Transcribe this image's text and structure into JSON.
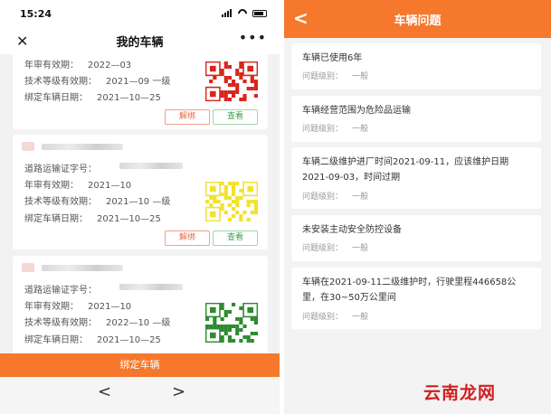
{
  "status": {
    "time": "15:24"
  },
  "left": {
    "title": "我的车辆",
    "close_icon": "close-icon",
    "more_icon": "more-icon",
    "cards": [
      {
        "rows": [
          {
            "label": "年审有效期：",
            "value": "2022—03"
          },
          {
            "label": "技术等级有效期：",
            "value": "2021—09 一级"
          },
          {
            "label": "绑定车辆日期：",
            "value": "2021—10—25"
          }
        ],
        "qr_color": "#d9261c",
        "buttons": {
          "unbind": "解绑",
          "view": "查看"
        }
      },
      {
        "rows": [
          {
            "label": "道路运输证字号：",
            "value": ""
          },
          {
            "label": "年审有效期：",
            "value": "2021—10"
          },
          {
            "label": "技术等级有效期：",
            "value": "2021—10 —级"
          },
          {
            "label": "绑定车辆日期：",
            "value": "2021—10—25"
          }
        ],
        "qr_color": "#f2e22a",
        "buttons": {
          "unbind": "解绑",
          "view": "查看"
        }
      },
      {
        "rows": [
          {
            "label": "道路运输证字号：",
            "value": ""
          },
          {
            "label": "年审有效期：",
            "value": "2021—10"
          },
          {
            "label": "技术等级有效期：",
            "value": "2022—10 —级"
          },
          {
            "label": "绑定车辆日期：",
            "value": "2021—10—25"
          }
        ],
        "qr_color": "#2e8b2e"
      }
    ],
    "bind_button": "绑定车辆",
    "nav": {
      "prev": "<",
      "next": ">"
    }
  },
  "right": {
    "title": "车辆问题",
    "back": "<",
    "level_label": "问题级别：",
    "issues": [
      {
        "text": "车辆已使用6年",
        "level": "一般"
      },
      {
        "text": "车辆经营范围为危险品运输",
        "level": "一般"
      },
      {
        "text": "车辆二级维护进厂时间2021-09-11，应该维护日期2021-09-03，时间过期",
        "level": "一般"
      },
      {
        "text": "未安装主动安全防控设备",
        "level": "一般"
      },
      {
        "text": "车辆在2021-09-11二级维护时，行驶里程446658公里，在30~50万公里间",
        "level": "一般"
      }
    ]
  },
  "watermark": "云南龙网",
  "colors": {
    "accent": "#f5782c",
    "unbind": "#e8684a",
    "view": "#37a347"
  }
}
